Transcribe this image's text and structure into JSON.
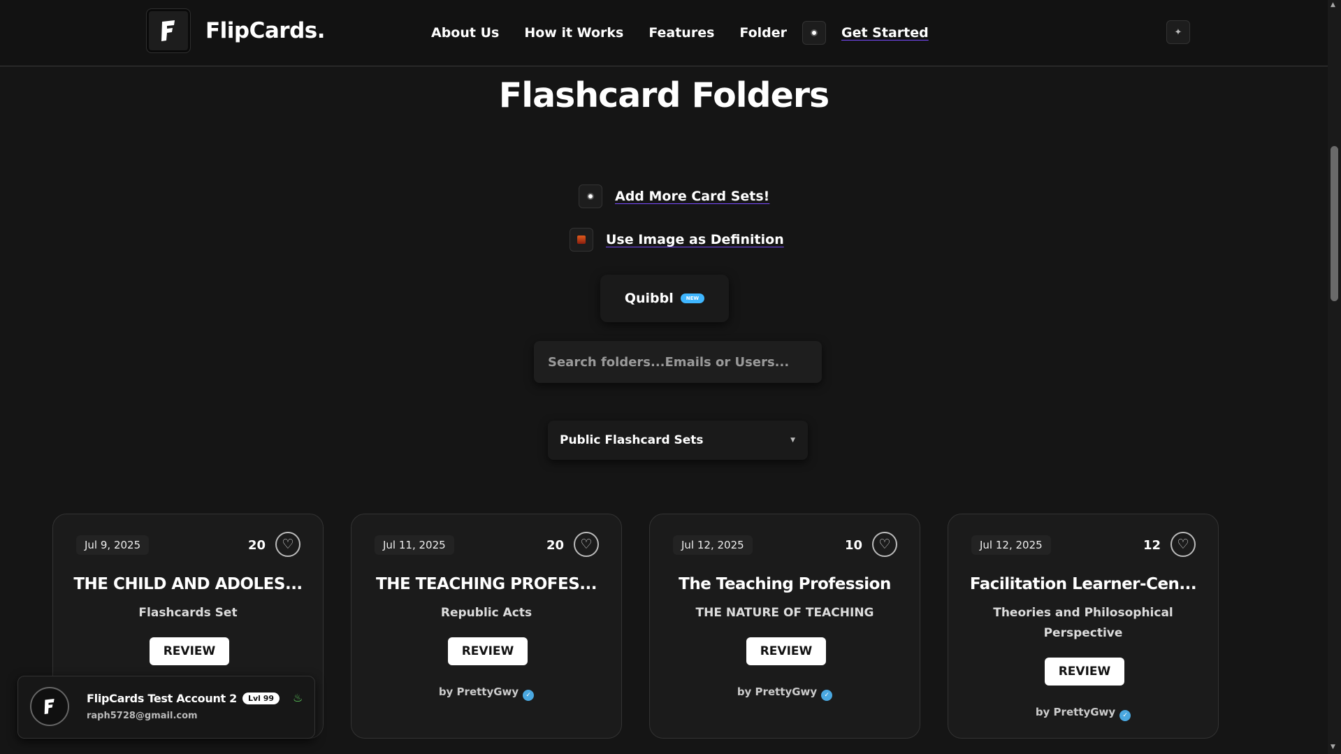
{
  "header": {
    "brand": "FlipCards.",
    "nav": [
      "About Us",
      "How it Works",
      "Features",
      "Folder"
    ],
    "get_started": "Get Started"
  },
  "main": {
    "title": "Flashcard Folders",
    "add_sets": "Add More Card Sets!",
    "image_def": "Use Image as Definition",
    "quibbl": "Quibbl",
    "quibbl_badge": "NEW",
    "search_placeholder": "Search folders...Emails or Users...",
    "filter_selected": "Public Flashcard Sets"
  },
  "cards": [
    {
      "date": "Jul 9, 2025",
      "count": "20",
      "title": "THE CHILD AND ADOLES...",
      "subtitle": "Flashcards Set",
      "review": "REVIEW",
      "author": ""
    },
    {
      "date": "Jul 11, 2025",
      "count": "20",
      "title": "THE TEACHING PROFES...",
      "subtitle": "Republic Acts",
      "review": "REVIEW",
      "author": "by PrettyGwy"
    },
    {
      "date": "Jul 12, 2025",
      "count": "10",
      "title": "The Teaching Profession",
      "subtitle": "THE NATURE OF TEACHING",
      "review": "REVIEW",
      "author": "by PrettyGwy"
    },
    {
      "date": "Jul 12, 2025",
      "count": "12",
      "title": "Facilitation Learner-Cen...",
      "subtitle": "Theories and Philosophical Perspective",
      "review": "REVIEW",
      "author": "by PrettyGwy"
    }
  ],
  "account": {
    "name": "FlipCards Test Account 2",
    "level": "Lvl 99",
    "email": "raph5728@gmail.com"
  },
  "colors": {
    "accent_underline": "#7a4cff",
    "badge_blue": "#3fb6ff",
    "verified_blue": "#4aa8e0",
    "flame_green": "#5fd35f"
  }
}
